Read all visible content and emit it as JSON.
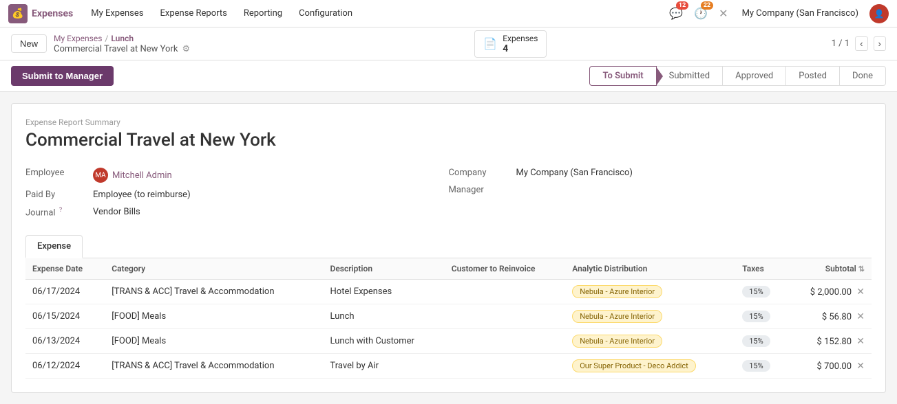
{
  "navbar": {
    "brand": "Expenses",
    "logo_char": "💰",
    "nav_items": [
      {
        "label": "My Expenses",
        "active": false
      },
      {
        "label": "Expense Reports",
        "active": false
      },
      {
        "label": "Reporting",
        "active": false
      },
      {
        "label": "Configuration",
        "active": false
      }
    ],
    "notif1_count": "12",
    "notif2_count": "22",
    "company": "My Company (San Francisco)",
    "user_initials": "MA"
  },
  "breadcrumb": {
    "new_label": "New",
    "parent_link": "My Expenses",
    "sep": "/",
    "current": "Lunch",
    "subtitle": "Commercial Travel at New York",
    "doc_button_label": "Expenses",
    "doc_count": "4",
    "pagination": "1 / 1"
  },
  "action_bar": {
    "submit_btn_label": "Submit to Manager",
    "statuses": [
      {
        "label": "To Submit",
        "active": true
      },
      {
        "label": "Submitted",
        "active": false
      },
      {
        "label": "Approved",
        "active": false
      },
      {
        "label": "Posted",
        "active": false
      },
      {
        "label": "Done",
        "active": false
      }
    ]
  },
  "report": {
    "section_label": "Expense Report Summary",
    "title": "Commercial Travel at New York",
    "fields": {
      "employee_label": "Employee",
      "employee_value": "Mitchell Admin",
      "employee_initials": "MA",
      "paid_by_label": "Paid By",
      "paid_by_value": "Employee (to reimburse)",
      "journal_label": "Journal",
      "journal_tooltip": "?",
      "journal_value": "Vendor Bills",
      "company_label": "Company",
      "company_value": "My Company (San Francisco)",
      "manager_label": "Manager",
      "manager_value": ""
    }
  },
  "expense_tab": {
    "tab_label": "Expense",
    "table": {
      "columns": [
        {
          "label": "Expense Date",
          "key": "date"
        },
        {
          "label": "Category",
          "key": "category"
        },
        {
          "label": "Description",
          "key": "description"
        },
        {
          "label": "Customer to Reinvoice",
          "key": "customer"
        },
        {
          "label": "Analytic Distribution",
          "key": "analytic"
        },
        {
          "label": "Taxes",
          "key": "taxes"
        },
        {
          "label": "Subtotal",
          "key": "subtotal",
          "align": "right"
        }
      ],
      "rows": [
        {
          "date": "06/17/2024",
          "category": "[TRANS & ACC] Travel & Accommodation",
          "description": "Hotel Expenses",
          "customer": "",
          "analytic": "Nebula - Azure Interior",
          "analytic_color": "yellow",
          "taxes": "15%",
          "subtotal": "$ 2,000.00"
        },
        {
          "date": "06/15/2024",
          "category": "[FOOD] Meals",
          "description": "Lunch",
          "customer": "",
          "analytic": "Nebula - Azure Interior",
          "analytic_color": "yellow",
          "taxes": "15%",
          "subtotal": "$ 56.80"
        },
        {
          "date": "06/13/2024",
          "category": "[FOOD] Meals",
          "description": "Lunch with Customer",
          "customer": "",
          "analytic": "Nebula - Azure Interior",
          "analytic_color": "yellow",
          "taxes": "15%",
          "subtotal": "$ 152.80"
        },
        {
          "date": "06/12/2024",
          "category": "[TRANS & ACC] Travel & Accommodation",
          "description": "Travel by Air",
          "customer": "",
          "analytic": "Our Super Product - Deco Addict",
          "analytic_color": "yellow",
          "taxes": "15%",
          "subtotal": "$ 700.00"
        }
      ]
    }
  }
}
